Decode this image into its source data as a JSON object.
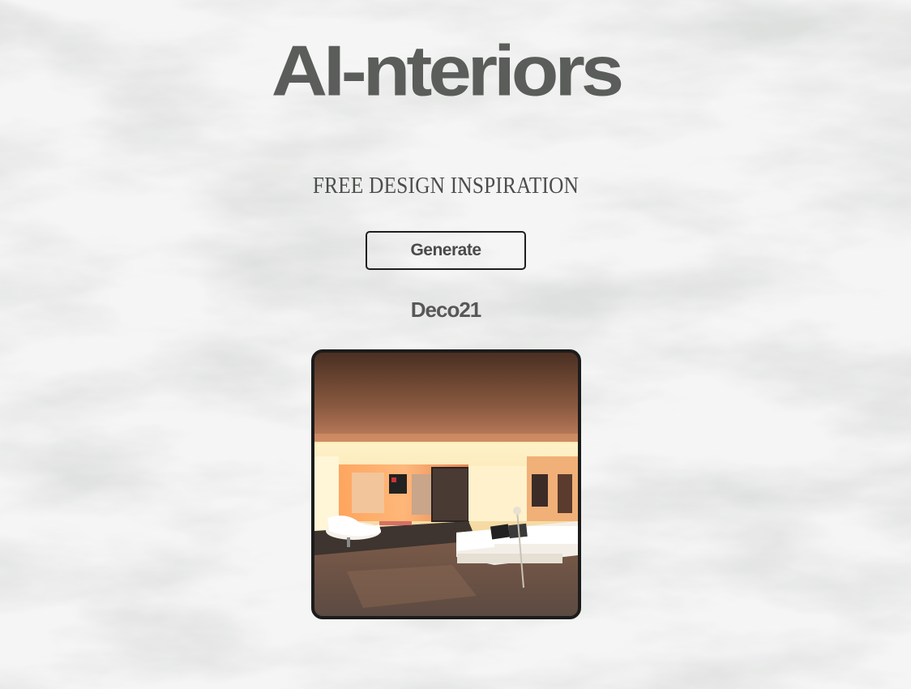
{
  "header": {
    "title": "AI-nteriors",
    "subtitle": "FREE DESIGN INSPIRATION"
  },
  "actions": {
    "generate_label": "Generate"
  },
  "result": {
    "style_name": "Deco21",
    "image_description_icon": "interior-photo"
  },
  "colors": {
    "title": "#5a5d59",
    "background": "#f3f4f3",
    "button_border": "#1e1e1e"
  }
}
